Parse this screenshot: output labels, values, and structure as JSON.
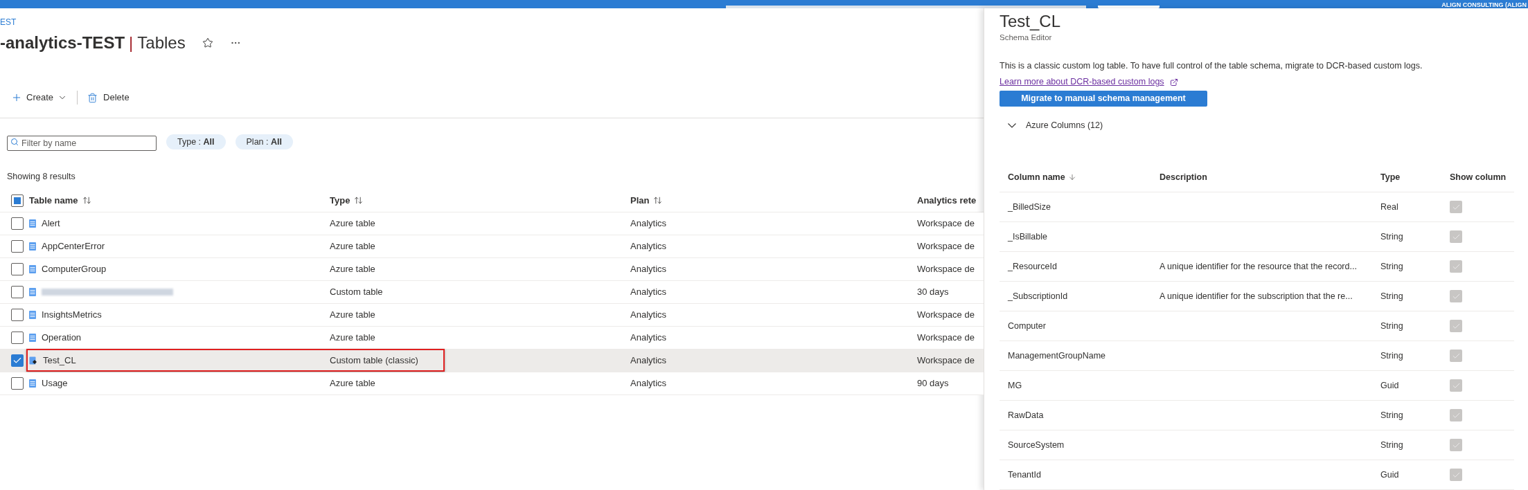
{
  "top_bar": {
    "account": "ALIGN CONSULTING (ALIGN"
  },
  "breadcrumb": "EST",
  "page": {
    "title": "-analytics-TEST",
    "separator": "|",
    "subtitle": "Tables"
  },
  "toolbar": [
    {
      "label": "Create",
      "kind": "create"
    },
    {
      "label": "Delete",
      "kind": "delete"
    }
  ],
  "filter": {
    "placeholder": "Filter by name"
  },
  "pills": [
    {
      "label": "Type :",
      "value": "All"
    },
    {
      "label": "Plan :",
      "value": "All"
    }
  ],
  "results_count": "Showing 8 results",
  "table": {
    "header_indeterminate": true,
    "columns": [
      {
        "label": "Table name",
        "sortable": true
      },
      {
        "label": "Type",
        "sortable": true
      },
      {
        "label": "Plan",
        "sortable": true
      },
      {
        "label": "Analytics rete",
        "sortable": false
      }
    ],
    "rows": [
      {
        "name": "Alert",
        "redacted": false,
        "kind": "table",
        "type": "Azure table",
        "plan": "Analytics",
        "retention": "Workspace de",
        "selected": false,
        "highlighted": false
      },
      {
        "name": "AppCenterError",
        "redacted": false,
        "kind": "table",
        "type": "Azure table",
        "plan": "Analytics",
        "retention": "Workspace de",
        "selected": false,
        "highlighted": false
      },
      {
        "name": "ComputerGroup",
        "redacted": false,
        "kind": "table",
        "type": "Azure table",
        "plan": "Analytics",
        "retention": "Workspace de",
        "selected": false,
        "highlighted": false
      },
      {
        "redacted": true,
        "kind": "table",
        "type": "Custom table",
        "plan": "Analytics",
        "retention": "30 days",
        "selected": false,
        "highlighted": false
      },
      {
        "name": "InsightsMetrics",
        "redacted": false,
        "kind": "table",
        "type": "Azure table",
        "plan": "Analytics",
        "retention": "Workspace de",
        "selected": false,
        "highlighted": false
      },
      {
        "name": "Operation",
        "redacted": false,
        "kind": "table",
        "type": "Azure table",
        "plan": "Analytics",
        "retention": "Workspace de",
        "selected": false,
        "highlighted": false
      },
      {
        "name": "Test_CL",
        "redacted": false,
        "kind": "classic",
        "type": "Custom table (classic)",
        "plan": "Analytics",
        "retention": "Workspace de",
        "selected": true,
        "highlighted": true
      },
      {
        "name": "Usage",
        "redacted": false,
        "kind": "table",
        "type": "Azure table",
        "plan": "Analytics",
        "retention": "90 days",
        "selected": false,
        "highlighted": false
      }
    ]
  },
  "panel": {
    "title": "Test_CL",
    "subtitle": "Schema Editor",
    "notice": "This is a classic custom log table. To have full control of the table schema, migrate to DCR-based custom logs.",
    "link": "Learn more about DCR-based custom logs",
    "button": "Migrate to manual schema management",
    "section": {
      "label": "Azure Columns (12)",
      "expanded": true
    },
    "columns": [
      {
        "label": "Column name",
        "sorted": true
      },
      {
        "label": "Description",
        "sorted": false
      },
      {
        "label": "Type",
        "sorted": false
      },
      {
        "label": "Show column",
        "sorted": false
      }
    ],
    "rows": [
      {
        "name": "_BilledSize",
        "type": "Real",
        "checked": true,
        "disabled": true
      },
      {
        "name": "_IsBillable",
        "type": "String",
        "checked": true,
        "disabled": true
      },
      {
        "name": "_ResourceId",
        "description": "A unique identifier for the resource that the record...",
        "type": "String",
        "checked": true,
        "disabled": true
      },
      {
        "name": "_SubscriptionId",
        "description": "A unique identifier for the subscription that the re...",
        "type": "String",
        "checked": true,
        "disabled": true
      },
      {
        "name": "Computer",
        "type": "String",
        "checked": true,
        "disabled": true
      },
      {
        "name": "ManagementGroupName",
        "type": "String",
        "checked": true,
        "disabled": true
      },
      {
        "name": "MG",
        "type": "Guid",
        "checked": true,
        "disabled": true
      },
      {
        "name": "RawData",
        "type": "String",
        "checked": true,
        "disabled": true
      },
      {
        "name": "SourceSystem",
        "type": "String",
        "checked": true,
        "disabled": true
      },
      {
        "name": "TenantId",
        "type": "Guid",
        "checked": true,
        "disabled": true
      }
    ]
  }
}
